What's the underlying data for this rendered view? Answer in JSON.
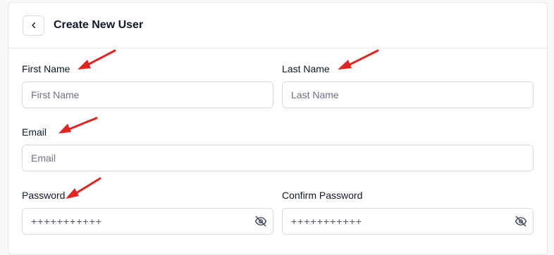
{
  "header": {
    "title": "Create New User",
    "back_icon": "chevron-left-icon"
  },
  "form": {
    "first_name": {
      "label": "First Name",
      "placeholder": "First Name"
    },
    "last_name": {
      "label": "Last Name",
      "placeholder": "Last Name"
    },
    "email": {
      "label": "Email",
      "placeholder": "Email"
    },
    "password": {
      "label": "Password",
      "value": "+++++++++++",
      "toggle_icon": "eye-off-icon"
    },
    "confirm_password": {
      "label": "Confirm Password",
      "value": "+++++++++++",
      "toggle_icon": "eye-off-icon"
    }
  },
  "annotations": {
    "arrow_color": "#e02424",
    "arrow_icon": "red-arrow"
  }
}
